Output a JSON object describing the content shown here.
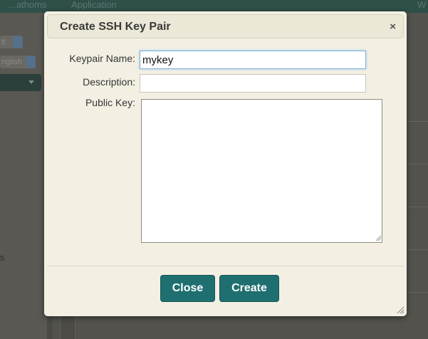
{
  "background": {
    "topbar": {
      "item1": "...athoms",
      "item2": "Application",
      "item3": "W"
    },
    "left_select_1_value": "it",
    "left_select_2_value": "nglish",
    "side_letter": "s"
  },
  "modal": {
    "title": "Create SSH Key Pair",
    "close_glyph": "×",
    "fields": {
      "keypair_name_label": "Keypair Name:",
      "keypair_name_value": "mykey",
      "description_label": "Description:",
      "description_value": "",
      "public_key_label": "Public Key:",
      "public_key_value": ""
    },
    "buttons": {
      "close": "Close",
      "create": "Create"
    }
  },
  "colors": {
    "accent": "#1f6f70",
    "modal_bg": "#f3f0e3",
    "focus_ring": "#7fb2d8"
  }
}
